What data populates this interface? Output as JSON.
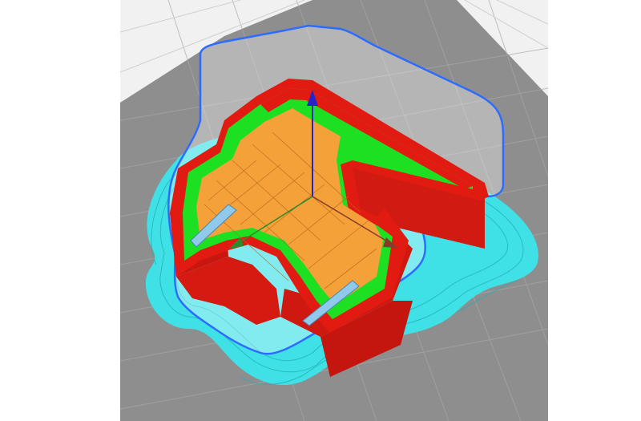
{
  "viewer": {
    "view": "layer-preview",
    "colors": {
      "background": "#ffffff",
      "bed_white": "#f1f1f1",
      "bed_gray": "#8e8e8e",
      "grid_line": "#a9a9a9",
      "skirt_brim": "#3fe0e6",
      "skirt_brim_dark": "#22aeb6",
      "outer_wall": "#e21b12",
      "inner_wall": "#1ee023",
      "infill": "#f4a13a",
      "support_blue": "#8fc9ec",
      "travel": "#2d6cff",
      "axis_arrow": "#2424c8"
    },
    "icons": [
      "z-axis-arrow-icon"
    ]
  }
}
